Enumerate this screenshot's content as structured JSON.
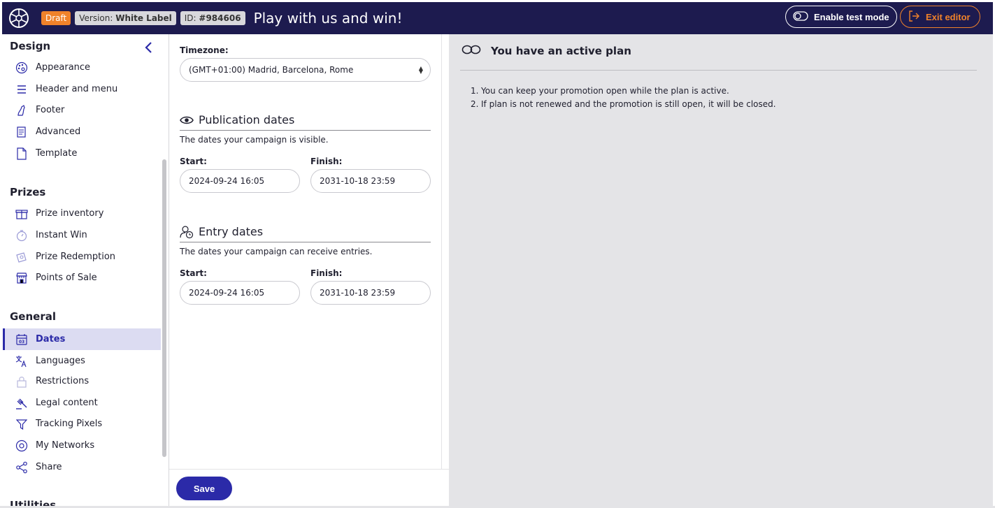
{
  "header": {
    "status_badge": "Draft",
    "version_label": "Version: ",
    "version_value": "White Label",
    "id_label": "ID: ",
    "id_value": "#984606",
    "title": "Play with us and win!",
    "test_mode_label": "Enable test mode",
    "exit_label": "Exit editor",
    "accent_color": "#f0822a",
    "bar_color": "#1d1b4f"
  },
  "sidebar": {
    "sections": [
      {
        "title": "Design",
        "items": [
          {
            "label": "Appearance",
            "icon": "palette-icon"
          },
          {
            "label": "Header and menu",
            "icon": "menu-icon"
          },
          {
            "label": "Footer",
            "icon": "footer-icon"
          },
          {
            "label": "Advanced",
            "icon": "advanced-icon"
          },
          {
            "label": "Template",
            "icon": "template-icon"
          }
        ]
      },
      {
        "title": "Prizes",
        "items": [
          {
            "label": "Prize inventory",
            "icon": "gift-icon"
          },
          {
            "label": "Instant Win",
            "icon": "stopwatch-icon"
          },
          {
            "label": "Prize Redemption",
            "icon": "redemption-icon"
          },
          {
            "label": "Points of Sale",
            "icon": "store-icon"
          }
        ]
      },
      {
        "title": "General",
        "items": [
          {
            "label": "Dates",
            "icon": "calendar-icon",
            "active": true
          },
          {
            "label": "Languages",
            "icon": "translate-icon"
          },
          {
            "label": "Restrictions",
            "icon": "lock-icon"
          },
          {
            "label": "Legal content",
            "icon": "gavel-icon"
          },
          {
            "label": "Tracking Pixels",
            "icon": "filter-icon"
          },
          {
            "label": "My Networks",
            "icon": "globe-icon"
          },
          {
            "label": "Share",
            "icon": "share-icon"
          }
        ]
      }
    ],
    "next_section_peek": "Utilities",
    "active_color": "#2b2aa8"
  },
  "form": {
    "timezone_label": "Timezone:",
    "timezone_value": "(GMT+01:00) Madrid, Barcelona, Rome",
    "publication": {
      "title": "Publication dates",
      "description": "The dates your campaign is visible.",
      "start_label": "Start:",
      "start_value": "2024-09-24 16:05",
      "finish_label": "Finish:",
      "finish_value": "2031-10-18 23:59"
    },
    "entry": {
      "title": "Entry dates",
      "description": "The dates your campaign can receive entries.",
      "start_label": "Start:",
      "start_value": "2024-09-24 16:05",
      "finish_label": "Finish:",
      "finish_value": "2031-10-18 23:59"
    },
    "save_label": "Save"
  },
  "plan": {
    "title": "You have an active plan",
    "items": [
      {
        "num": "1.",
        "text": "You can keep your promotion open while the plan is active."
      },
      {
        "num": "2.",
        "text": "If plan is not renewed and the promotion is still open, it will be closed."
      }
    ]
  }
}
